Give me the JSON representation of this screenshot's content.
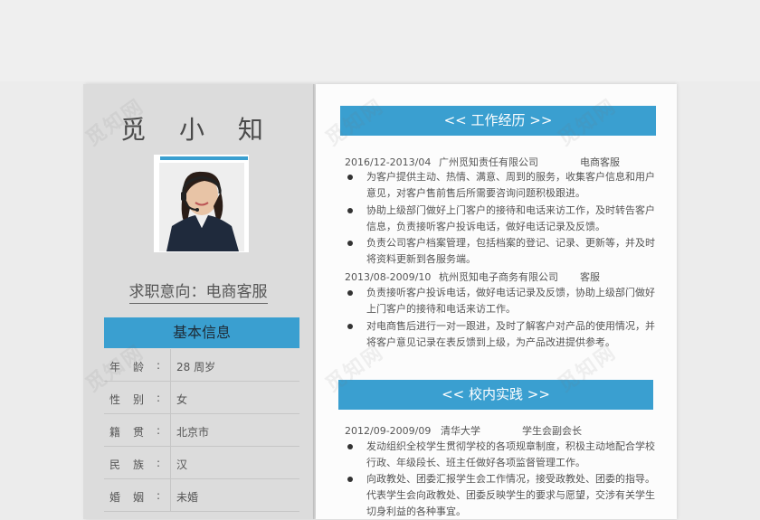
{
  "profile": {
    "name": "觅 小 知",
    "intent": "求职意向：电商客服",
    "photo_alt": "customer-service-headset-photo"
  },
  "basic_info": {
    "title": "基本信息",
    "rows": [
      {
        "label": "年龄",
        "value": "28 周岁"
      },
      {
        "label": "性别",
        "value": "女"
      },
      {
        "label": "籍贯",
        "value": "北京市"
      },
      {
        "label": "民族",
        "value": "汉"
      },
      {
        "label": "婚姻",
        "value": "未婚"
      }
    ]
  },
  "work": {
    "title": "<<  工作经历  >>",
    "jobs": [
      {
        "date": "2016/12-2013/04",
        "company": "广州觅知责任有限公司",
        "role": "电商客服",
        "bullets": [
          "为客户提供主动、热情、满意、周到的服务，收集客户信息和用户意见，对客户售前售后所需要咨询问题积极跟进。",
          "协助上级部门做好上门客户的接待和电话来访工作，及时转告客户信息，负责接听客户投诉电话，做好电话记录及反馈。",
          "负责公司客户档案管理，包括档案的登记、记录、更新等，并及时将资料更新到各服务端。"
        ]
      },
      {
        "date": "2013/08-2009/10",
        "company": "杭州觅知电子商务有限公司",
        "role": "客服",
        "bullets": [
          "负责接听客户投诉电话，做好电话记录及反馈，协助上级部门做好上门客户的接待和电话来访工作。",
          "对电商售后进行一对一跟进，及时了解客户对产品的使用情况，并将客户意见记录在表反馈到上级，为产品改进提供参考。"
        ]
      }
    ]
  },
  "campus": {
    "title": "<<  校内实践  >>",
    "date": "2012/09-2009/09",
    "org": "清华大学",
    "role": "学生会副会长",
    "bullets": [
      "发动组织全校学生贯彻学校的各项规章制度，积极主动地配合学校行政、年级段长、班主任做好各项监督管理工作。",
      "向政教处、团委汇报学生会工作情况，接受政教处、团委的指导。代表学生会向政教处、团委反映学生的要求与愿望，交涉有关学生切身利益的各种事宜。"
    ]
  },
  "watermark": "觅知网",
  "colors": {
    "accent": "#3a9fd0",
    "left_bg": "#dcdcdc",
    "right_bg": "#fcfcfc"
  }
}
